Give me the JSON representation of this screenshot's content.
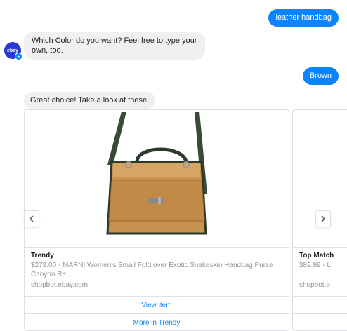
{
  "conversation": {
    "user_msg_1": "leather handbag",
    "bot_msg_1": "Which Color do you want?  Feel free to type your own, too.",
    "user_msg_2": "Brown",
    "bot_msg_2": "Great choice! Take a look at these."
  },
  "avatar": {
    "label": "ebay"
  },
  "carousel": {
    "cards": [
      {
        "title": "Trendy",
        "subtitle": "$279.00 - MARNI Women's Small Fold over Exotic Snakeskin Handbag Purse Canyon Re...",
        "domain": "shopbot.ebay.com",
        "buttons": [
          "View item",
          "More in Trendy"
        ]
      },
      {
        "title": "Top Match",
        "subtitle": "$89.99 - L",
        "domain": "shopbot.e"
      }
    ],
    "prev_icon": "chevron-left-icon",
    "next_icon": "chevron-right-icon"
  },
  "colors": {
    "accent": "#0a84ff",
    "bubble_in": "#f1f0f0",
    "avatar": "#2a3bd1"
  }
}
